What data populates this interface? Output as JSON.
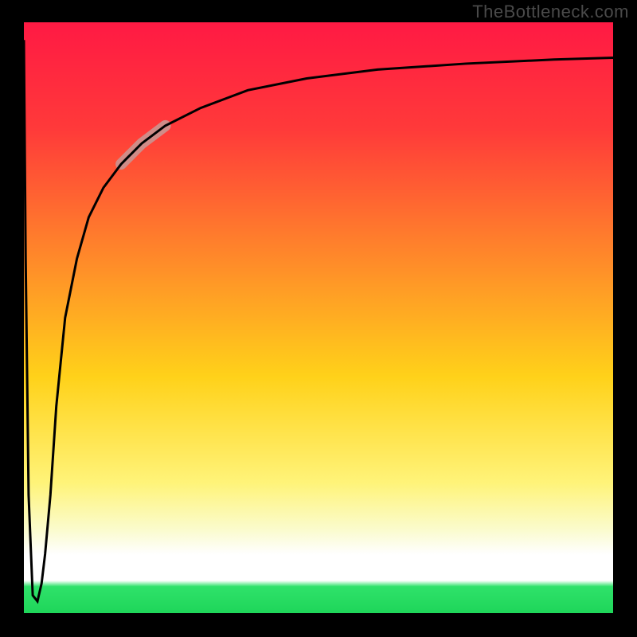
{
  "watermark": {
    "text": "TheBottleneck.com"
  },
  "chart_data": {
    "type": "line",
    "title": "",
    "xlabel": "",
    "ylabel": "",
    "xlim": [
      0,
      100
    ],
    "ylim": [
      0,
      100
    ],
    "grid": false,
    "legend": false,
    "gradient_stops": [
      {
        "offset": 0.0,
        "color": "#ff1a44"
      },
      {
        "offset": 0.18,
        "color": "#ff3a3a"
      },
      {
        "offset": 0.4,
        "color": "#ff8a2a"
      },
      {
        "offset": 0.6,
        "color": "#ffd21a"
      },
      {
        "offset": 0.78,
        "color": "#fff47a"
      },
      {
        "offset": 0.86,
        "color": "#fbfccf"
      },
      {
        "offset": 0.9,
        "color": "#ffffff"
      },
      {
        "offset": 0.945,
        "color": "#ffffff"
      },
      {
        "offset": 0.955,
        "color": "#2fe26a"
      },
      {
        "offset": 1.0,
        "color": "#1fd65a"
      }
    ],
    "series": [
      {
        "name": "main-curve",
        "color": "#000000",
        "stroke_width": 3,
        "x": [
          0.0,
          0.3,
          0.8,
          1.5,
          2.3,
          3.0,
          3.6,
          4.5,
          5.5,
          7.0,
          9.0,
          11.0,
          13.5,
          16.5,
          20.0,
          24.0,
          30.0,
          38.0,
          48.0,
          60.0,
          75.0,
          90.0,
          100.0
        ],
        "y": [
          97.0,
          60.0,
          20.0,
          3.0,
          2.0,
          5.0,
          10.0,
          20.0,
          35.0,
          50.0,
          60.0,
          67.0,
          72.0,
          76.0,
          79.5,
          82.5,
          85.5,
          88.5,
          90.5,
          92.0,
          93.0,
          93.7,
          94.0
        ]
      },
      {
        "name": "highlight-segment",
        "color": "#cf8c88",
        "stroke_width": 14,
        "linecap": "round",
        "x": [
          16.5,
          20.0,
          24.0
        ],
        "y": [
          76.0,
          79.5,
          82.5
        ]
      }
    ]
  }
}
